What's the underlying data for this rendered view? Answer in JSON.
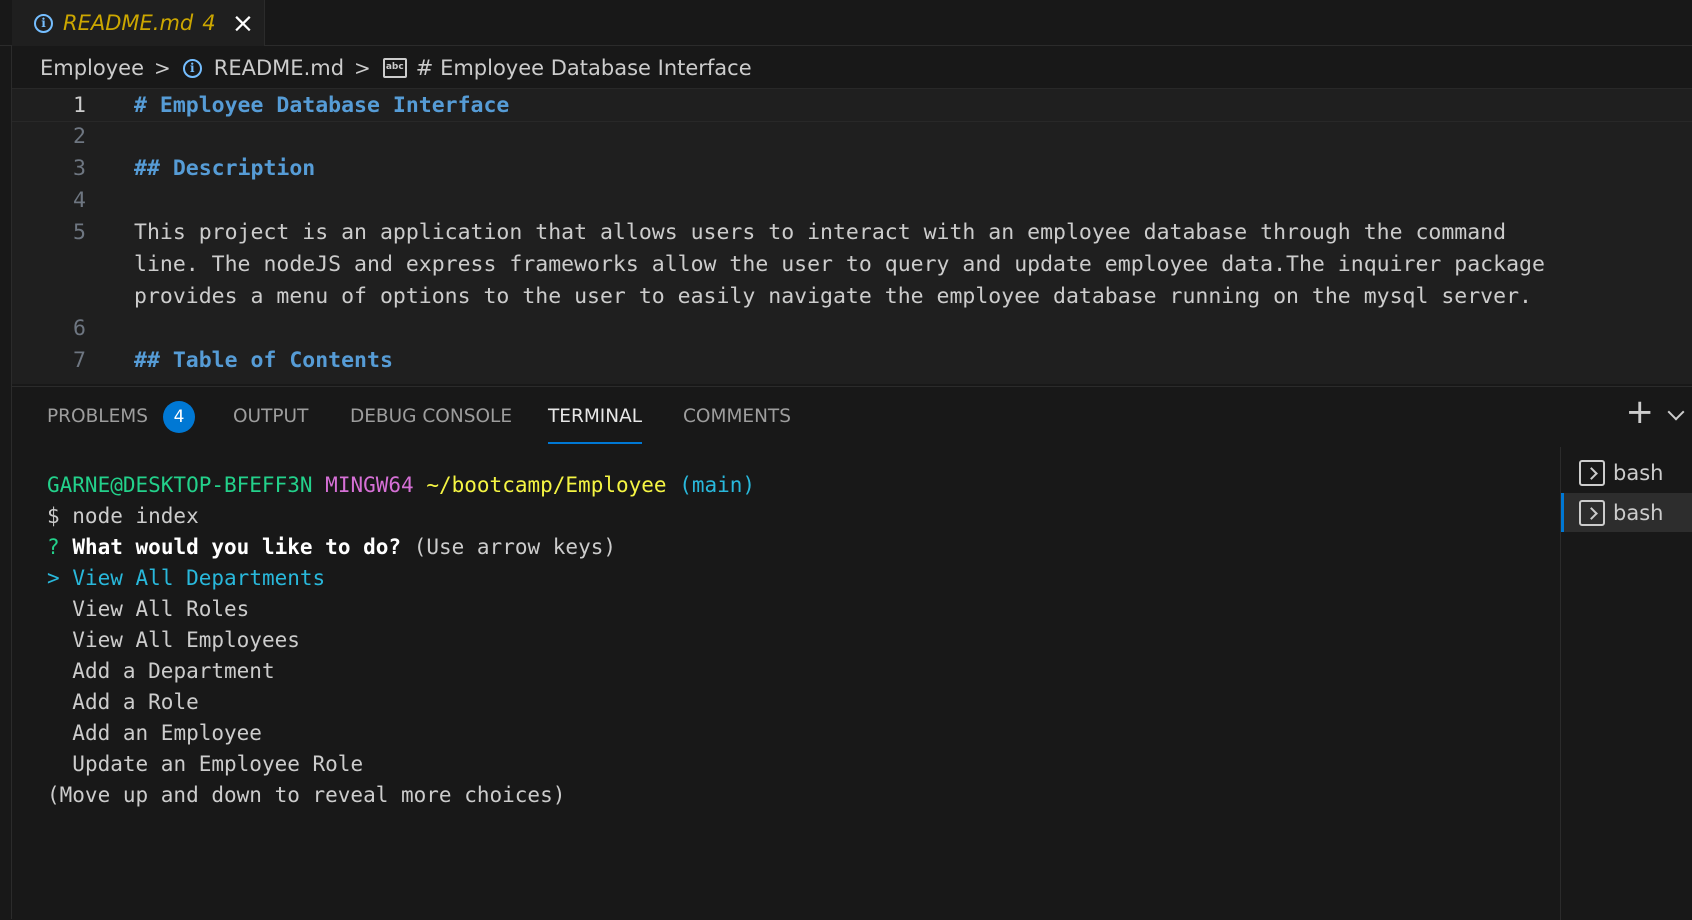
{
  "tab": {
    "name": "README.md",
    "count": "4",
    "close": "×"
  },
  "breadcrumb": {
    "folder": "Employee",
    "file": "README.md",
    "symbol": "# Employee Database Interface"
  },
  "editor": {
    "lines": [
      {
        "num": "1",
        "text": "# Employee Database Interface"
      },
      {
        "num": "2",
        "text": ""
      },
      {
        "num": "3",
        "text": "## Description"
      },
      {
        "num": "4",
        "text": ""
      },
      {
        "num": "5",
        "text": "This project is an application that allows users to interact with an employee database through the command"
      },
      {
        "num": "",
        "text": "line. The nodeJS and express frameworks allow the user to query and update employee data.The inquirer package"
      },
      {
        "num": "",
        "text": "provides a menu of options to the user to easily navigate the employee database running on the mysql server."
      },
      {
        "num": "6",
        "text": ""
      },
      {
        "num": "7",
        "text": "## Table of Contents"
      }
    ]
  },
  "panel": {
    "tabs": {
      "problems": "PROBLEMS",
      "problems_badge": "4",
      "output": "OUTPUT",
      "debug_console": "DEBUG CONSOLE",
      "terminal": "TERMINAL",
      "comments": "COMMENTS"
    },
    "plus": "+"
  },
  "terminal": {
    "prompt_user": "GARNE@DESKTOP-BFEFF3N",
    "prompt_env": "MINGW64",
    "prompt_path": "~/bootcamp/Employee",
    "prompt_branch": "(main)",
    "command": "$ node index",
    "question_mark": "?",
    "question": "What would you like to do?",
    "question_hint": "(Use arrow keys)",
    "selected_marker": ">",
    "choices": [
      "View All Departments",
      "View All Roles",
      "View All Employees",
      "Add a Department",
      "Add a Role",
      "Add an Employee",
      "Update an Employee Role"
    ],
    "footer": "(Move up and down to reveal more choices)"
  },
  "terminal_list": [
    {
      "label": "bash"
    },
    {
      "label": "bash"
    }
  ],
  "colors": {
    "accent": "#0078d4",
    "heading": "#569cd6",
    "warning": "#cca700"
  }
}
